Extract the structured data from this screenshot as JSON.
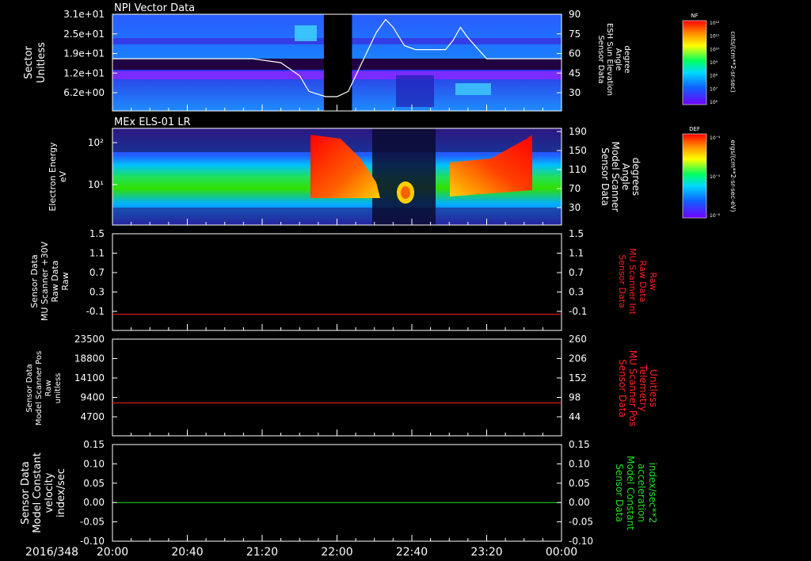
{
  "time_axis": {
    "date_label": "2016/348",
    "ticks": [
      "20:00",
      "20:40",
      "21:20",
      "22:00",
      "22:40",
      "23:20",
      "00:00"
    ],
    "range_minutes": [
      0,
      240
    ]
  },
  "chart_data": [
    {
      "type": "heatmap",
      "title": "NPI Vector Data",
      "ylabel": [
        "Sector",
        "Unitless"
      ],
      "y_ticks": [
        "3.1e+01",
        "2.5e+01",
        "1.9e+01",
        "1.2e+01",
        "6.2e+00"
      ],
      "right_ylabel": [
        "Sensor Data",
        "ESH Sun Elevation",
        "Angle",
        "degree"
      ],
      "right_ticks": [
        "90",
        "75",
        "60",
        "45",
        "30"
      ],
      "right_ylim": [
        20,
        90
      ],
      "data_gap_minutes": [
        113,
        128
      ],
      "elevation_curve": {
        "t": [
          0,
          75,
          90,
          100,
          105,
          114,
          120,
          126,
          135,
          141,
          146,
          150,
          156,
          162,
          170,
          178,
          182,
          186,
          190,
          200,
          240
        ],
        "deg": [
          56,
          56,
          53,
          43,
          31,
          27,
          27,
          31,
          58,
          76,
          86,
          80,
          66,
          63,
          63,
          63,
          70,
          80,
          72,
          56,
          56
        ]
      },
      "colorbar": {
        "title": "NF",
        "unit": "cnts/(cm**2-sr-sec)",
        "tick_labels": [
          "10¹²",
          "10¹¹",
          "10¹⁰",
          "10⁹",
          "10⁸",
          "10⁷",
          "10⁶"
        ],
        "colors": [
          "#ff0000",
          "#ff8c00",
          "#ffff00",
          "#00ff60",
          "#00d8ff",
          "#1060ff",
          "#7000ff"
        ]
      }
    },
    {
      "type": "heatmap",
      "title": "MEx ELS-01 LR",
      "ylabel": [
        "Electron Energy",
        "eV"
      ],
      "y_ticks": [
        "10²",
        "10¹"
      ],
      "right_ylabel": [
        "Sensor Data",
        "Model Scanner",
        "Angle",
        "degrees"
      ],
      "right_ticks": [
        "190",
        "150",
        "110",
        "70",
        "30"
      ],
      "energy_flux_features": [
        {
          "from_min": 0,
          "to_min": 76,
          "level": "green background band"
        },
        {
          "from_min": 76,
          "to_min": 112,
          "level": "high (red) declining"
        },
        {
          "from_min": 112,
          "to_min": 128,
          "level": "yellow"
        },
        {
          "from_min": 128,
          "to_min": 160,
          "level": "low with yellow blob"
        },
        {
          "from_min": 160,
          "to_min": 225,
          "level": "high (red) rising"
        }
      ],
      "colorbar": {
        "title": "DEF",
        "unit": "ergs/(cm**2-sr-sec-eV)",
        "tick_labels": [
          "10⁻⁴",
          "10⁻⁵",
          "10⁻⁶"
        ],
        "colors": [
          "#ff0000",
          "#ff8c00",
          "#ffff00",
          "#00ff60",
          "#00d8ff",
          "#1060ff",
          "#7000ff"
        ]
      }
    },
    {
      "type": "line",
      "ylabel": [
        "Sensor Data",
        "MU Scanner +30V",
        "Raw Data",
        "Raw"
      ],
      "right_ylabel": [
        "Sensor Data",
        "MU Scanner Int",
        "Raw Data",
        "Raw"
      ],
      "y_ticks": [
        "1.5",
        "1.1",
        "0.7",
        "0.3",
        "-0.1"
      ],
      "right_ticks": [
        "1.5",
        "1.1",
        "0.7",
        "0.3",
        "-0.1"
      ],
      "ylim": [
        -0.3,
        1.5
      ],
      "series": [
        {
          "values": [
            0.0,
            0.0
          ],
          "color": "#ff2020"
        }
      ],
      "x": [
        0,
        240
      ]
    },
    {
      "type": "line",
      "ylabel": [
        "Sensor Data",
        "Model Scanner Pos",
        "Raw",
        "unitless"
      ],
      "right_ylabel": [
        "Sensor Data",
        "MU Scanner Pos",
        "Telemetry",
        "Unitless"
      ],
      "y_ticks": [
        "23500",
        "18800",
        "14100",
        "9400",
        "4700"
      ],
      "right_ticks": [
        "260",
        "206",
        "152",
        "98",
        "44"
      ],
      "ylim": [
        0,
        23500
      ],
      "series": [
        {
          "values": [
            8000,
            8000
          ],
          "color": "#ff2020"
        }
      ],
      "x": [
        0,
        240
      ]
    },
    {
      "type": "line",
      "ylabel": [
        "Sensor Data",
        "Model Constant",
        "velocity",
        "index/sec"
      ],
      "right_ylabel": [
        "Sensor Data",
        "Model Constant",
        "acceleration",
        "index/sec**2"
      ],
      "y_ticks": [
        "0.15",
        "0.10",
        "0.05",
        "0.00",
        "-0.05",
        "-0.10"
      ],
      "right_ticks": [
        "0.15",
        "0.10",
        "0.05",
        "0.00",
        "-0.05",
        "-0.10"
      ],
      "ylim": [
        -0.1,
        0.15
      ],
      "series": [
        {
          "values": [
            0.0,
            0.0
          ],
          "color": "#20e020"
        }
      ],
      "x": [
        0,
        240
      ]
    }
  ],
  "colors": {
    "red_label": "#ff2020",
    "green_label": "#20e020",
    "axis": "#ffffff"
  }
}
